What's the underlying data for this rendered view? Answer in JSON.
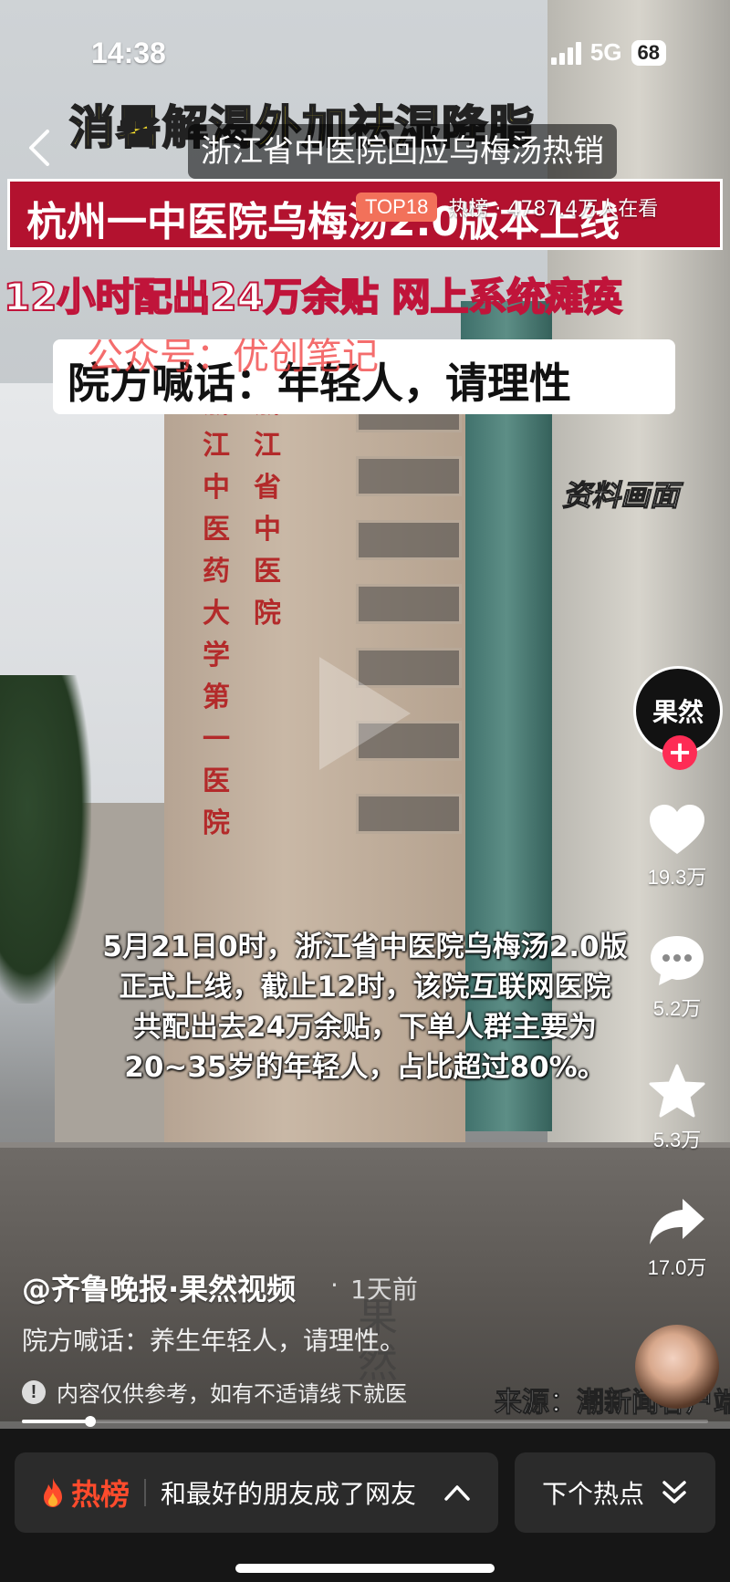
{
  "status_bar": {
    "time": "14:38",
    "network": "5G",
    "battery": "68"
  },
  "hot_header": {
    "title": "浙江省中医院回应乌梅汤热销",
    "rank_badge": "TOP18",
    "stats": "热榜 · 4787.4万人在看"
  },
  "video_overlay": {
    "headline_yellow": "消暑解渴外加祛湿降脂",
    "headline_red": "杭州一中医院乌梅汤2.0版本上线",
    "headline_line3": "12小时配出24万余贴 网上系统瘫痪",
    "headline_white": "院方喊话：年轻人，请理性",
    "watermark_gzh": "公众号：优创笔记",
    "archive_label": "资料画面",
    "building_sign_left": "浙江中医药大学第一医院",
    "building_sign_right": "浙江省中医院",
    "caption_lines": [
      "5月21日0时，浙江省中医院乌梅汤2.0版",
      "正式上线，截止12时，该院互联网医院",
      "共配出去24万余贴，下单人群主要为",
      "20~35岁的年轻人，占比超过80%。"
    ]
  },
  "actions": {
    "avatar_text": "果然",
    "likes": "19.3万",
    "comments": "5.2万",
    "favorites": "5.3万",
    "shares": "17.0万"
  },
  "info": {
    "author": "@齐鲁晚报·果然视频",
    "time_ago": "1天前",
    "description": "院方喊话：养生年轻人，请理性。",
    "disclaimer": "内容仅供参考，如有不适请线下就医",
    "source": "来源：潮新闻客户端",
    "watermark": "果然"
  },
  "progress": {
    "fraction": 0.1
  },
  "bottom_bar": {
    "hot_label": "热榜",
    "hot_topic": "和最好的朋友成了网友",
    "next_label": "下个热点"
  },
  "colors": {
    "accent_red": "#fe2c55",
    "hot_orange": "#fe4b2c",
    "badge": "#f2715a",
    "banner_red": "#b3122f",
    "headline_yellow": "#ffe62d"
  }
}
